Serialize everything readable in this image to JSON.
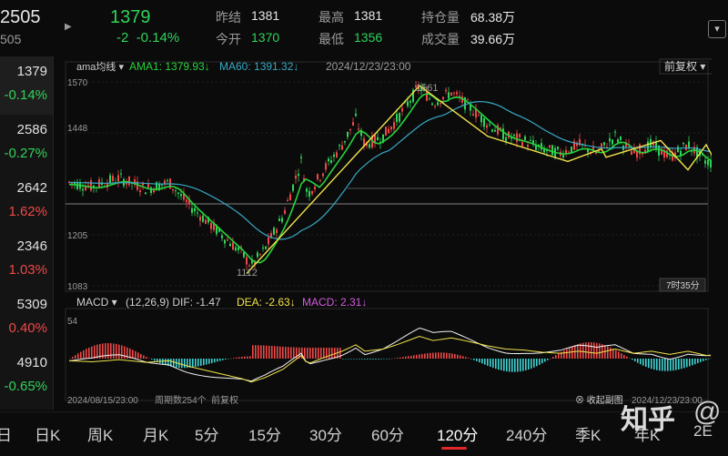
{
  "header": {
    "symbol_code": "2505",
    "symbol_sub": "505",
    "price": "1379",
    "change": "-2",
    "change_pct": "-0.14%",
    "stats": {
      "prev_close_label": "昨结",
      "prev_close": "1381",
      "open_label": "今开",
      "open": "1370",
      "high_label": "最高",
      "high": "1381",
      "low_label": "最低",
      "low": "1356",
      "oi_label": "持仓量",
      "oi": "68.38万",
      "vol_label": "成交量",
      "vol": "39.66万"
    }
  },
  "watchlist": [
    {
      "price": "1379",
      "change": "-0.14%",
      "color": "#2fd35a"
    },
    {
      "price": "2586",
      "change": "-0.27%",
      "color": "#2fd35a"
    },
    {
      "price": "2642",
      "change": "1.62%",
      "color": "#f04848"
    },
    {
      "price": "2346",
      "change": "1.03%",
      "color": "#f04848"
    },
    {
      "price": "5309",
      "change": "0.40%",
      "color": "#f04848"
    },
    {
      "price": "4910",
      "change": "-0.65%",
      "color": "#2fd35a"
    }
  ],
  "main_chart": {
    "indicator_label": "ama均线",
    "ama1_label": "AMA1: 1379.93",
    "ma60_label": "MA60: 1391.32",
    "datetime": "2024/12/23/23:00",
    "adjust": "前复权",
    "y_labels": [
      "1570",
      "1448",
      "1205",
      "1083"
    ],
    "high_mark": "1561",
    "low_mark": "1112",
    "countdown": "7时35分"
  },
  "macd": {
    "title": "MACD",
    "params": "(12,26,9)",
    "dif_label": "DIF: -1.47",
    "dea_label": "DEA: -2.63",
    "macd_label": "MACD: 2.31",
    "y_top": "54",
    "start_date": "2024/08/15/23:00",
    "period_count": "周期数254个",
    "adjust": "前复权",
    "collapse": "收起副图",
    "end_date": "2024/12/23/23:00"
  },
  "tabs": [
    "日",
    "日K",
    "周K",
    "月K",
    "5分",
    "15分",
    "30分",
    "60分",
    "120分",
    "240分",
    "季K",
    "年K",
    "2E"
  ],
  "active_tab": "120分",
  "watermark": {
    "text": "知乎",
    "at": "@"
  },
  "colors": {
    "up": "#f04848",
    "down": "#2fd35a",
    "ama": "#27d33b",
    "ma60": "#37a9c4",
    "zigzag": "#f2e34b"
  }
}
